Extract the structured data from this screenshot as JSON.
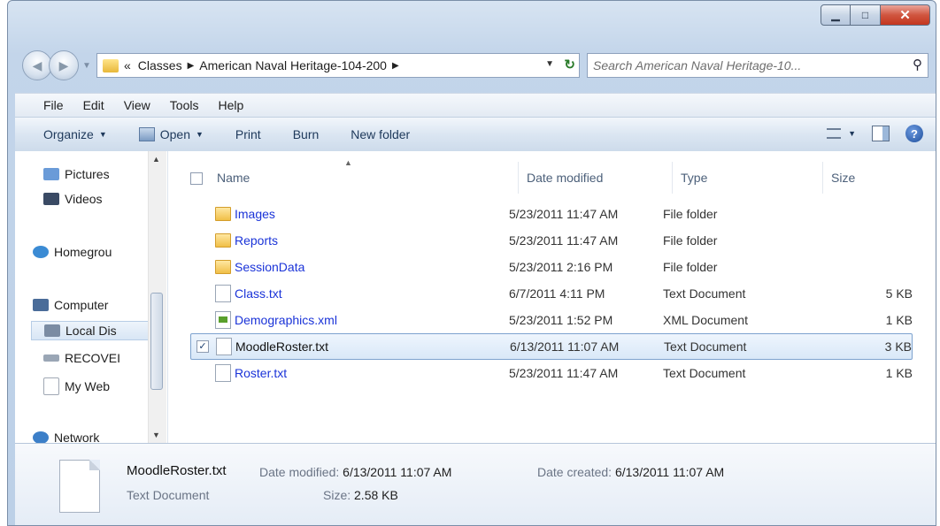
{
  "window": {
    "caption_buttons": {
      "minimize": "▁",
      "maximize": "□",
      "close": "✕"
    }
  },
  "address": {
    "overflow": "«",
    "crumbs": [
      "Classes",
      "American Naval Heritage-104-200"
    ],
    "search_placeholder": "Search American Naval Heritage-10..."
  },
  "menu": [
    "File",
    "Edit",
    "View",
    "Tools",
    "Help"
  ],
  "commands": {
    "organize": "Organize",
    "open": "Open",
    "print": "Print",
    "burn": "Burn",
    "new_folder": "New folder",
    "help": "?"
  },
  "nav_pane": {
    "items": [
      "Pictures",
      "Videos",
      "Homegrou",
      "Computer",
      "Local Dis",
      "RECOVEI",
      "My Web",
      "Network"
    ],
    "colors": {
      "pictures": "#6a9bd8",
      "videos": "#3a4a64",
      "homegroup": "#3b8bd4",
      "computer": "#4a6c99",
      "local": "#7b8ca3",
      "recovery": "#9aa6b5",
      "web": "#ffffff",
      "network": "#3c7fc8"
    }
  },
  "columns": {
    "name": "Name",
    "date": "Date modified",
    "type": "Type",
    "size": "Size"
  },
  "files": [
    {
      "name": "Images",
      "date": "5/23/2011 11:47 AM",
      "type": "File folder",
      "size": "",
      "icon": "folder"
    },
    {
      "name": "Reports",
      "date": "5/23/2011 11:47 AM",
      "type": "File folder",
      "size": "",
      "icon": "folder"
    },
    {
      "name": "SessionData",
      "date": "5/23/2011 2:16 PM",
      "type": "File folder",
      "size": "",
      "icon": "folder"
    },
    {
      "name": "Class.txt",
      "date": "6/7/2011 4:11 PM",
      "type": "Text Document",
      "size": "5 KB",
      "icon": "doc"
    },
    {
      "name": "Demographics.xml",
      "date": "5/23/2011 1:52 PM",
      "type": "XML Document",
      "size": "1 KB",
      "icon": "xml"
    },
    {
      "name": "MoodleRoster.txt",
      "date": "6/13/2011 11:07 AM",
      "type": "Text Document",
      "size": "3 KB",
      "icon": "doc",
      "selected": "✓"
    },
    {
      "name": "Roster.txt",
      "date": "5/23/2011 11:47 AM",
      "type": "Text Document",
      "size": "1 KB",
      "icon": "doc"
    }
  ],
  "details": {
    "name": "MoodleRoster.txt",
    "date_modified_label": "Date modified:",
    "date_modified": "6/13/2011 11:07 AM",
    "date_created_label": "Date created:",
    "date_created": "6/13/2011 11:07 AM",
    "type": "Text Document",
    "size_label": "Size:",
    "size": "2.58 KB"
  }
}
